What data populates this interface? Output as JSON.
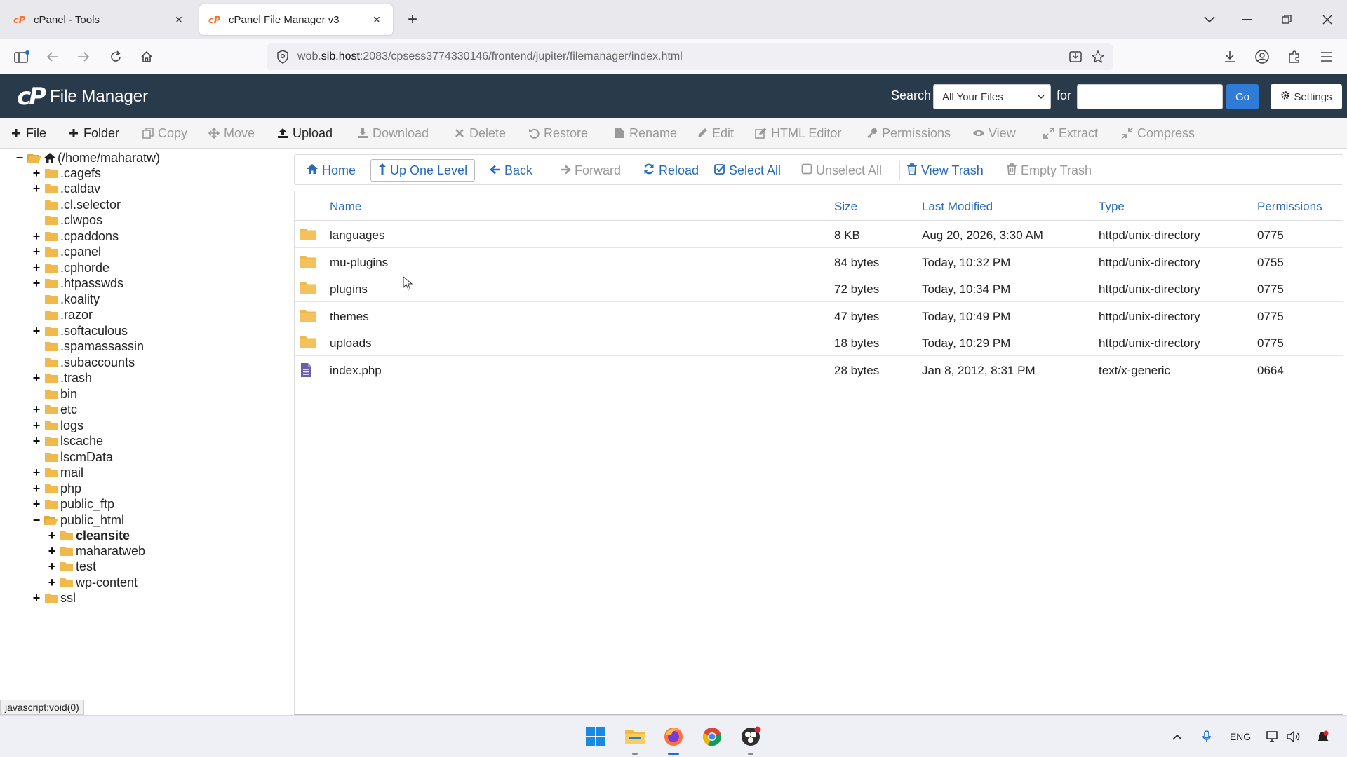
{
  "browser": {
    "tabs": [
      {
        "title": "cPanel - Tools",
        "active": false
      },
      {
        "title": "cPanel File Manager v3",
        "active": true
      }
    ],
    "url": {
      "prefix": "wob.",
      "host": "sib.host",
      "rest": ":2083/cpsess3774330146/frontend/jupiter/filemanager/index.html"
    }
  },
  "header": {
    "logo_mark": "cP",
    "app_title": "File Manager",
    "search_label": "Search",
    "search_scope": "All Your Files",
    "for_label": "for",
    "search_value": "",
    "go_label": "Go",
    "settings_label": "Settings"
  },
  "toolbar": [
    {
      "label": "File",
      "icon": "plus-icon",
      "enabled": true
    },
    {
      "label": "Folder",
      "icon": "plus-icon",
      "enabled": true
    },
    {
      "label": "Copy",
      "icon": "copy-icon",
      "enabled": false
    },
    {
      "label": "Move",
      "icon": "move-icon",
      "enabled": false
    },
    {
      "label": "Upload",
      "icon": "upload-icon",
      "enabled": true
    },
    {
      "label": "Download",
      "icon": "download-icon",
      "enabled": false
    },
    {
      "label": "Delete",
      "icon": "close-icon",
      "enabled": false
    },
    {
      "label": "Restore",
      "icon": "undo-icon",
      "enabled": false
    },
    {
      "label": "Rename",
      "icon": "file-icon",
      "enabled": false
    },
    {
      "label": "Edit",
      "icon": "pencil-icon",
      "enabled": false
    },
    {
      "label": "HTML Editor",
      "icon": "edit-square-icon",
      "enabled": false
    },
    {
      "label": "Permissions",
      "icon": "key-icon",
      "enabled": false
    },
    {
      "label": "View",
      "icon": "eye-icon",
      "enabled": false
    },
    {
      "label": "Extract",
      "icon": "expand-icon",
      "enabled": false
    },
    {
      "label": "Compress",
      "icon": "compress-icon",
      "enabled": false
    }
  ],
  "tree": [
    {
      "label": "(/home/maharatw)",
      "expander": "−",
      "icon": "open-folder-home",
      "indent": 0
    },
    {
      "label": ".cagefs",
      "expander": "+",
      "icon": "folder",
      "indent": 1
    },
    {
      "label": ".caldav",
      "expander": "+",
      "icon": "folder",
      "indent": 1
    },
    {
      "label": ".cl.selector",
      "expander": "",
      "icon": "folder",
      "indent": 1
    },
    {
      "label": ".clwpos",
      "expander": "",
      "icon": "folder",
      "indent": 1
    },
    {
      "label": ".cpaddons",
      "expander": "+",
      "icon": "folder",
      "indent": 1
    },
    {
      "label": ".cpanel",
      "expander": "+",
      "icon": "folder",
      "indent": 1
    },
    {
      "label": ".cphorde",
      "expander": "+",
      "icon": "folder",
      "indent": 1
    },
    {
      "label": ".htpasswds",
      "expander": "+",
      "icon": "folder",
      "indent": 1
    },
    {
      "label": ".koality",
      "expander": "",
      "icon": "folder",
      "indent": 1
    },
    {
      "label": ".razor",
      "expander": "",
      "icon": "folder",
      "indent": 1
    },
    {
      "label": ".softaculous",
      "expander": "+",
      "icon": "folder",
      "indent": 1
    },
    {
      "label": ".spamassassin",
      "expander": "",
      "icon": "folder",
      "indent": 1
    },
    {
      "label": ".subaccounts",
      "expander": "",
      "icon": "folder",
      "indent": 1
    },
    {
      "label": ".trash",
      "expander": "+",
      "icon": "folder",
      "indent": 1
    },
    {
      "label": "bin",
      "expander": "",
      "icon": "folder",
      "indent": 1
    },
    {
      "label": "etc",
      "expander": "+",
      "icon": "folder",
      "indent": 1
    },
    {
      "label": "logs",
      "expander": "+",
      "icon": "folder",
      "indent": 1
    },
    {
      "label": "lscache",
      "expander": "+",
      "icon": "folder",
      "indent": 1
    },
    {
      "label": "lscmData",
      "expander": "",
      "icon": "folder",
      "indent": 1
    },
    {
      "label": "mail",
      "expander": "+",
      "icon": "folder",
      "indent": 1
    },
    {
      "label": "php",
      "expander": "+",
      "icon": "folder",
      "indent": 1
    },
    {
      "label": "public_ftp",
      "expander": "+",
      "icon": "folder",
      "indent": 1
    },
    {
      "label": "public_html",
      "expander": "−",
      "icon": "open-folder",
      "indent": 1
    },
    {
      "label": "cleansite",
      "expander": "+",
      "icon": "folder",
      "indent": 2,
      "bold": true
    },
    {
      "label": "maharatweb",
      "expander": "+",
      "icon": "folder",
      "indent": 2
    },
    {
      "label": "test",
      "expander": "+",
      "icon": "folder",
      "indent": 2
    },
    {
      "label": "wp-content",
      "expander": "+",
      "icon": "folder",
      "indent": 2
    },
    {
      "label": "ssl",
      "expander": "+",
      "icon": "folder",
      "indent": 1
    }
  ],
  "nav_buttons": [
    {
      "label": "Home",
      "icon": "home-icon",
      "enabled": true
    },
    {
      "label": "Up One Level",
      "icon": "level-up-icon",
      "enabled": true
    },
    {
      "label": "Back",
      "icon": "arrow-left-icon",
      "enabled": true
    },
    {
      "label": "Forward",
      "icon": "arrow-right-icon",
      "enabled": false
    },
    {
      "label": "Reload",
      "icon": "refresh-icon",
      "enabled": true
    },
    {
      "label": "Select All",
      "icon": "checkbox-checked-icon",
      "enabled": true
    },
    {
      "label": "Unselect All",
      "icon": "checkbox-empty-icon",
      "enabled": false
    },
    {
      "label": "View Trash",
      "icon": "trash-icon",
      "enabled": true
    },
    {
      "label": "Empty Trash",
      "icon": "trash-icon",
      "enabled": false
    }
  ],
  "table": {
    "columns": [
      "Name",
      "Size",
      "Last Modified",
      "Type",
      "Permissions"
    ],
    "rows": [
      {
        "kind": "folder",
        "name": "languages",
        "size": "8 KB",
        "modified": "Aug 20, 2026, 3:30 AM",
        "type": "httpd/unix-directory",
        "perms": "0775"
      },
      {
        "kind": "folder",
        "name": "mu-plugins",
        "size": "84 bytes",
        "modified": "Today, 10:32 PM",
        "type": "httpd/unix-directory",
        "perms": "0755"
      },
      {
        "kind": "folder",
        "name": "plugins",
        "size": "72 bytes",
        "modified": "Today, 10:34 PM",
        "type": "httpd/unix-directory",
        "perms": "0775"
      },
      {
        "kind": "folder",
        "name": "themes",
        "size": "47 bytes",
        "modified": "Today, 10:49 PM",
        "type": "httpd/unix-directory",
        "perms": "0775"
      },
      {
        "kind": "folder",
        "name": "uploads",
        "size": "18 bytes",
        "modified": "Today, 10:29 PM",
        "type": "httpd/unix-directory",
        "perms": "0775"
      },
      {
        "kind": "file",
        "name": "index.php",
        "size": "28 bytes",
        "modified": "Jan 8, 2012, 8:31 PM",
        "type": "text/x-generic",
        "perms": "0664"
      }
    ]
  },
  "status_text": "javascript:void(0)",
  "taskbar": {
    "apps": [
      "windows-start",
      "file-explorer",
      "firefox",
      "chrome",
      "obs-studio"
    ],
    "tray_lang": "ENG"
  },
  "colors": {
    "header_bg": "#293a4a",
    "link_blue": "#2a6bb8",
    "go_button": "#2f7bd6",
    "folder_yellow": "#f0b94c",
    "file_purple": "#6b5ea8"
  }
}
